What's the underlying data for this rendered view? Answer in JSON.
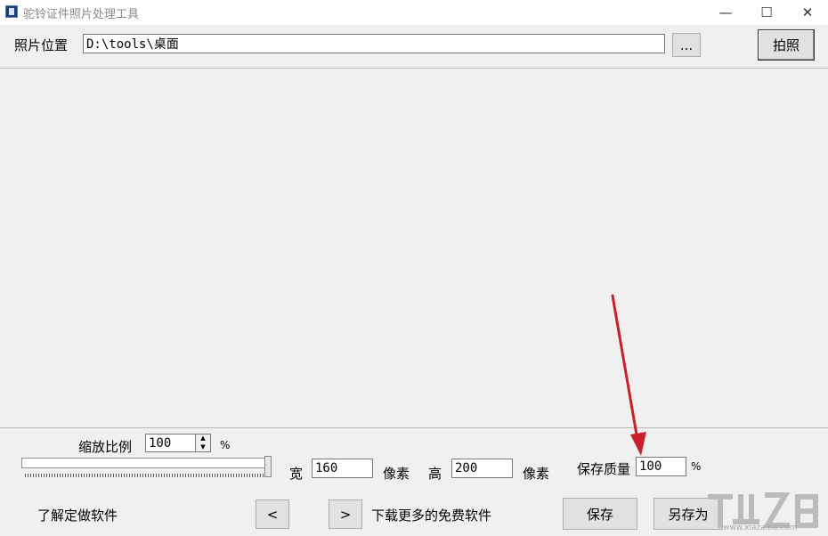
{
  "window": {
    "title": "驼铃证件照片处理工具",
    "controls": {
      "minimize": "—",
      "maximize": "☐",
      "close": "✕"
    }
  },
  "location": {
    "label": "照片位置",
    "value": "D:\\tools\\桌面",
    "browse_label": "...",
    "capture_label": "拍照"
  },
  "zoom": {
    "label": "缩放比例",
    "value": "100",
    "unit": "%"
  },
  "size": {
    "width_label": "宽",
    "width_value": "160",
    "width_unit": "像素",
    "height_label": "高",
    "height_value": "200",
    "height_unit": "像素"
  },
  "quality": {
    "label": "保存质量",
    "value": "100",
    "unit": "%"
  },
  "footer": {
    "learn_label": "了解定做软件",
    "prev_label": "<",
    "next_label": ">",
    "download_label": "下载更多的免费软件",
    "save_label": "保存",
    "save_as_label": "另存为"
  },
  "watermark": {
    "site": "www.xiazaiba.com"
  },
  "colors": {
    "annotation_arrow": "#c8202a",
    "accent": "#0078d7"
  }
}
